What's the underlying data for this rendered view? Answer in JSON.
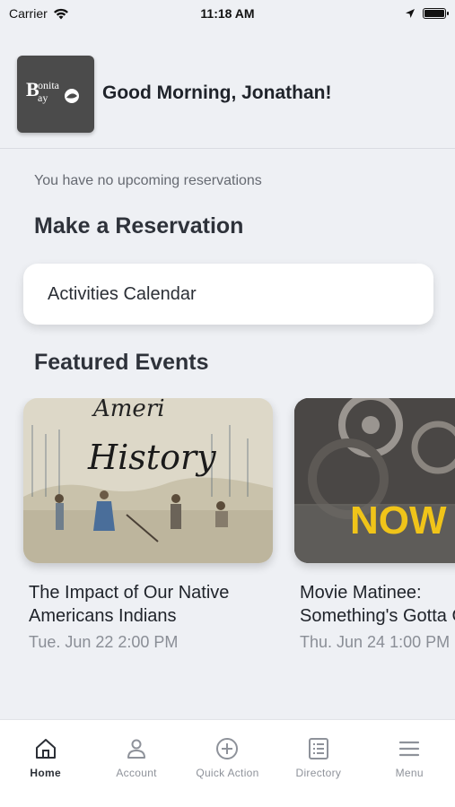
{
  "status_bar": {
    "carrier": "Carrier",
    "time": "11:18 AM"
  },
  "header": {
    "logo_text": "Bonita Bay",
    "greeting": "Good Morning, Jonathan!"
  },
  "reservations": {
    "empty_message": "You have no upcoming reservations",
    "section_title": "Make a Reservation",
    "activities_label": "Activities Calendar"
  },
  "featured": {
    "section_title": "Featured Events",
    "events": [
      {
        "title_line1": "The Impact of Our Native",
        "title_line2": "Americans Indians",
        "date": "Tue. Jun 22 2:00 PM",
        "image_text": "History"
      },
      {
        "title_line1": "Movie Matinee:",
        "title_line2": "Something's Gotta Give",
        "date": "Thu. Jun 24 1:00 PM",
        "image_text": "NOW SHOWING"
      }
    ]
  },
  "tabbar": {
    "items": [
      {
        "label": "Home",
        "icon": "home-icon",
        "active": true
      },
      {
        "label": "Account",
        "icon": "person-icon",
        "active": false
      },
      {
        "label": "Quick Action",
        "icon": "plus-circle-icon",
        "active": false
      },
      {
        "label": "Directory",
        "icon": "list-icon",
        "active": false
      },
      {
        "label": "Menu",
        "icon": "hamburger-icon",
        "active": false
      }
    ]
  }
}
